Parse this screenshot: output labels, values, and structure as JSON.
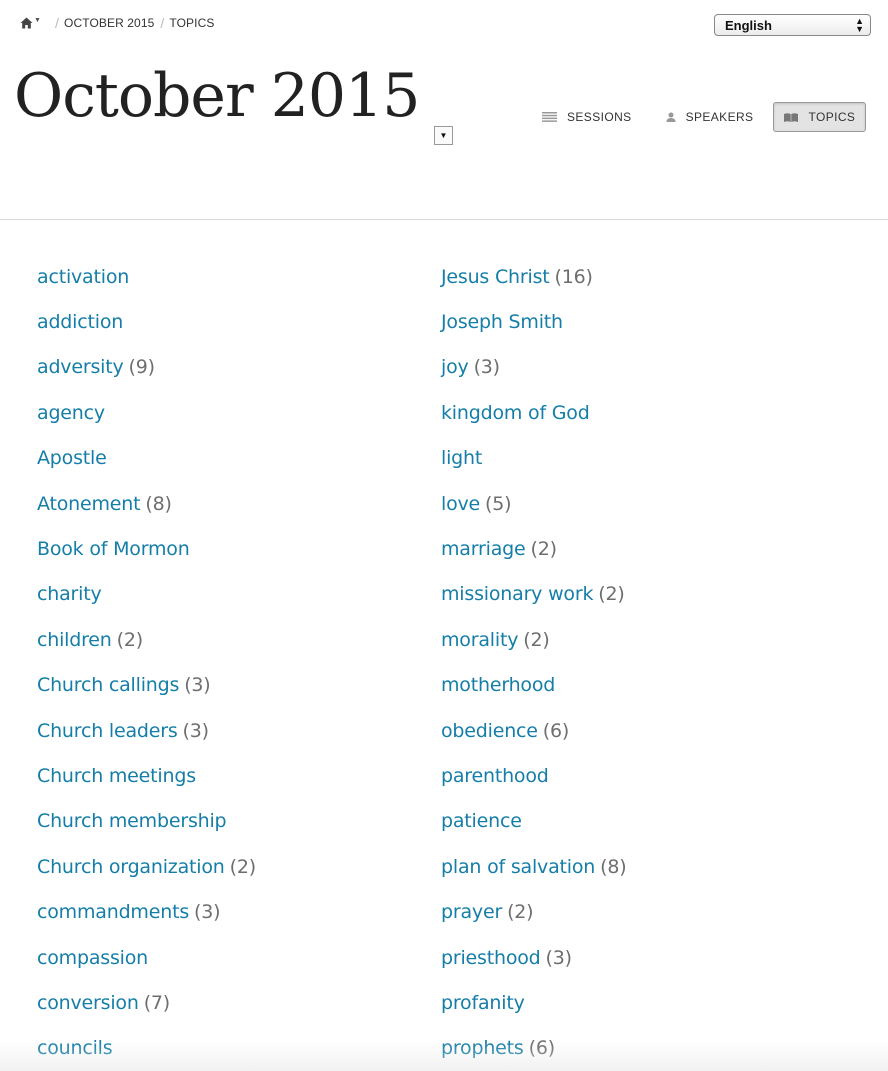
{
  "breadcrumb": {
    "items": [
      "October 2015",
      "Topics"
    ]
  },
  "language": {
    "selected": "English"
  },
  "header": {
    "title": "October 2015"
  },
  "tabs": [
    {
      "label": "Sessions",
      "icon": "list-icon"
    },
    {
      "label": "Speakers",
      "icon": "person-icon"
    },
    {
      "label": "Topics",
      "icon": "book-icon",
      "active": true
    }
  ],
  "colors": {
    "link": "#157ea8",
    "count": "#6e6e6e",
    "divider": "#dcdcdc"
  },
  "topics": {
    "left": [
      {
        "name": "activation",
        "count": ""
      },
      {
        "name": "addiction",
        "count": ""
      },
      {
        "name": "adversity",
        "count": "(9)"
      },
      {
        "name": "agency",
        "count": ""
      },
      {
        "name": "Apostle",
        "count": ""
      },
      {
        "name": "Atonement",
        "count": "(8)"
      },
      {
        "name": "Book of Mormon",
        "count": ""
      },
      {
        "name": "charity",
        "count": ""
      },
      {
        "name": "children",
        "count": "(2)"
      },
      {
        "name": "Church callings",
        "count": "(3)"
      },
      {
        "name": "Church leaders",
        "count": "(3)"
      },
      {
        "name": "Church meetings",
        "count": ""
      },
      {
        "name": "Church membership",
        "count": ""
      },
      {
        "name": "Church organization",
        "count": "(2)"
      },
      {
        "name": "commandments",
        "count": "(3)"
      },
      {
        "name": "compassion",
        "count": ""
      },
      {
        "name": "conversion",
        "count": "(7)"
      },
      {
        "name": "councils",
        "count": ""
      }
    ],
    "right": [
      {
        "name": "Jesus Christ",
        "count": "(16)"
      },
      {
        "name": "Joseph Smith",
        "count": ""
      },
      {
        "name": "joy",
        "count": "(3)"
      },
      {
        "name": "kingdom of God",
        "count": ""
      },
      {
        "name": "light",
        "count": ""
      },
      {
        "name": "love",
        "count": "(5)"
      },
      {
        "name": "marriage",
        "count": "(2)"
      },
      {
        "name": "missionary work",
        "count": "(2)"
      },
      {
        "name": "morality",
        "count": "(2)"
      },
      {
        "name": "motherhood",
        "count": ""
      },
      {
        "name": "obedience",
        "count": "(6)"
      },
      {
        "name": "parenthood",
        "count": ""
      },
      {
        "name": "patience",
        "count": ""
      },
      {
        "name": "plan of salvation",
        "count": "(8)"
      },
      {
        "name": "prayer",
        "count": "(2)"
      },
      {
        "name": "priesthood",
        "count": "(3)"
      },
      {
        "name": "profanity",
        "count": ""
      },
      {
        "name": "prophets",
        "count": "(6)"
      }
    ]
  }
}
